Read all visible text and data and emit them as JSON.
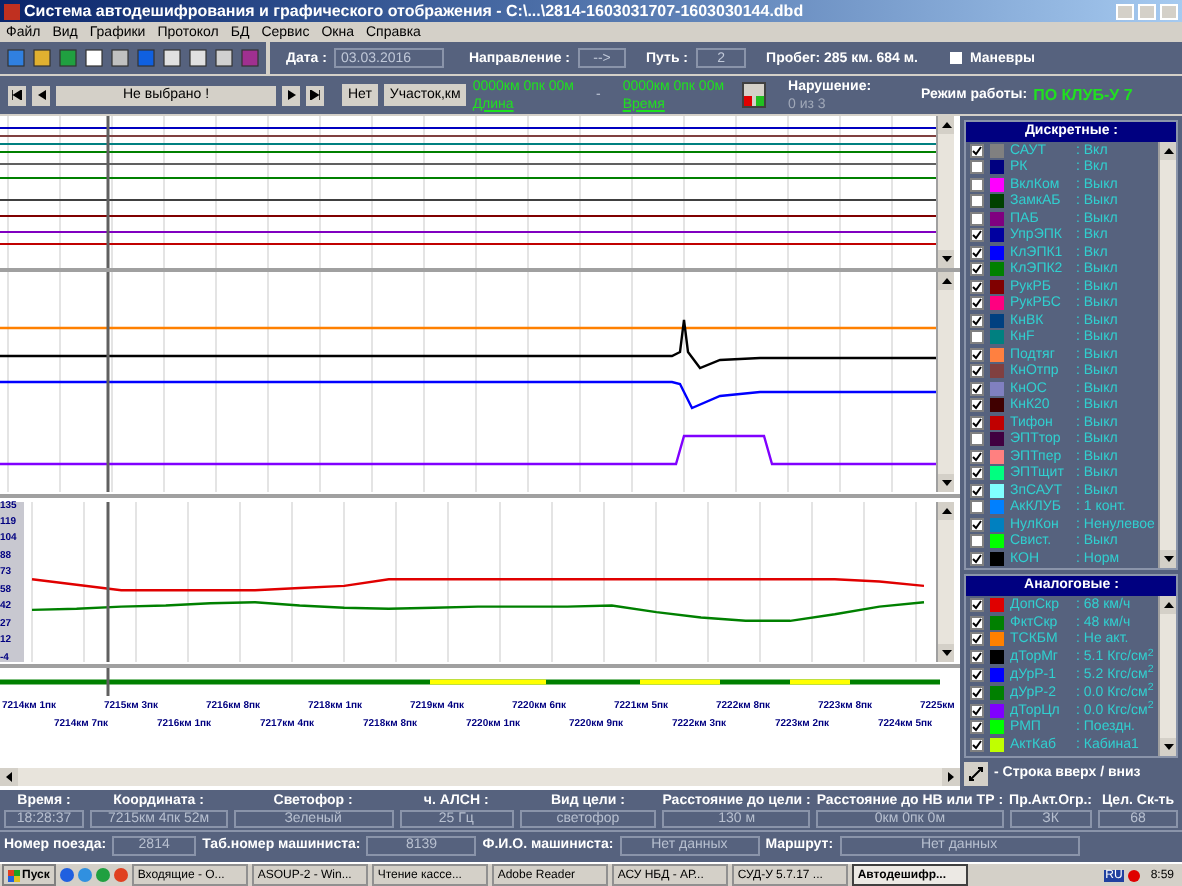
{
  "window": {
    "title": "Система автодешифрования и графического отображения - C:\\...\\2814-1603031707-1603030144.dbd"
  },
  "menu": [
    "Файл",
    "Вид",
    "Графики",
    "Протокол",
    "БД",
    "Сервис",
    "Окна",
    "Справка"
  ],
  "toolbar": {
    "date_label": "Дата :",
    "date": "03.03.2016",
    "direction_label": "Направление :",
    "direction": "-->",
    "track_label": "Путь :",
    "track": "2",
    "mileage": "Пробег: 285 км. 684 м.",
    "maneuvers": {
      "label": "Маневры",
      "checked": false
    }
  },
  "navigation": {
    "selection": "Не выбрано !",
    "no_button": "Нет",
    "section_button": "Участок,км",
    "from": "0000км 0пк 00м",
    "length_link": "Длина",
    "dash": "-",
    "to": "0000км 0пк 00м",
    "time_link": "Время",
    "violation_label": "Нарушение:",
    "violation_count": "0 из 3",
    "mode_label": "Режим работы:",
    "mode": "ПО КЛУБ-У 7"
  },
  "analog_chart": {
    "chart_data": {
      "type": "line",
      "grid": true,
      "ylim": [
        -4,
        135
      ],
      "yticks": [
        -4,
        12,
        27,
        42,
        58,
        73,
        88,
        104,
        119,
        135
      ],
      "series": [
        {
          "color": "#e00000",
          "values": [
            68,
            63,
            58,
            58,
            58,
            58,
            60,
            62,
            68,
            68,
            68,
            68,
            68,
            68,
            68,
            68,
            68,
            68,
            68,
            66,
            62
          ]
        },
        {
          "color": "#008000",
          "values": [
            40,
            41,
            43,
            44,
            46,
            47,
            44,
            42,
            41,
            42,
            43,
            43,
            43,
            44,
            38,
            33,
            30,
            30,
            36,
            43,
            47
          ]
        }
      ]
    }
  },
  "position_scale": {
    "row_1": [
      "7214км 1пк",
      "7215км 3пк",
      "7216км 8пк",
      "7218км 1пк",
      "7219км 4пк",
      "7220км 6пк",
      "7221км 5пк",
      "7222км 8пк",
      "7223км 8пк",
      "7225км"
    ],
    "row_2": [
      "7214км 7пк",
      "7216км 1пк",
      "7217км 4пк",
      "7218км 8пк",
      "7220км 1пк",
      "7220км 9пк",
      "7222км 3пк",
      "7223км 2пк",
      "7224км 5пк"
    ]
  },
  "discrete": {
    "title": "Дискретные :",
    "items": [
      {
        "name": "САУТ",
        "value": ": Вкл",
        "color": "#808080",
        "checked": true
      },
      {
        "name": "РК",
        "value": ": Вкл",
        "color": "#000080",
        "checked": false
      },
      {
        "name": "ВклКом",
        "value": ": Выкл",
        "color": "#ff00ff",
        "checked": false
      },
      {
        "name": "ЗамкАБ",
        "value": ": Выкл",
        "color": "#004000",
        "checked": false
      },
      {
        "name": "ПАБ",
        "value": ": Выкл",
        "color": "#800080",
        "checked": false
      },
      {
        "name": "УпрЭПК",
        "value": ": Вкл",
        "color": "#0000a0",
        "checked": true
      },
      {
        "name": "КлЭПК1",
        "value": ": Вкл",
        "color": "#0000ff",
        "checked": true
      },
      {
        "name": "КлЭПК2",
        "value": ": Выкл",
        "color": "#008000",
        "checked": true
      },
      {
        "name": "РукРБ",
        "value": ": Выкл",
        "color": "#800000",
        "checked": true
      },
      {
        "name": "РукРБС",
        "value": ": Выкл",
        "color": "#ff0080",
        "checked": true
      },
      {
        "name": "КнВК",
        "value": ": Выкл",
        "color": "#004080",
        "checked": true
      },
      {
        "name": "КнF",
        "value": ": Выкл",
        "color": "#008080",
        "checked": false
      },
      {
        "name": "Подтяг",
        "value": ": Выкл",
        "color": "#ff8040",
        "checked": true
      },
      {
        "name": "КнОтпр",
        "value": ": Выкл",
        "color": "#804040",
        "checked": true
      },
      {
        "name": "КнОС",
        "value": ": Выкл",
        "color": "#8080c0",
        "checked": true
      },
      {
        "name": "КнК20",
        "value": ": Выкл",
        "color": "#400000",
        "checked": true
      },
      {
        "name": "Тифон",
        "value": ": Выкл",
        "color": "#c00000",
        "checked": true
      },
      {
        "name": "ЭПТтор",
        "value": ": Выкл",
        "color": "#400040",
        "checked": false
      },
      {
        "name": "ЭПТпер",
        "value": ": Выкл",
        "color": "#ff8080",
        "checked": true
      },
      {
        "name": "ЭПТщит",
        "value": ": Выкл",
        "color": "#00ff80",
        "checked": true
      },
      {
        "name": "ЗпСАУТ",
        "value": ": Выкл",
        "color": "#80ffff",
        "checked": true
      },
      {
        "name": "АкКЛУБ",
        "value": ": 1 конт.",
        "color": "#0080ff",
        "checked": false
      },
      {
        "name": "НулКон",
        "value": ": Ненулевое",
        "color": "#0080c0",
        "checked": true
      },
      {
        "name": "Свист.",
        "value": ": Выкл",
        "color": "#00ff00",
        "checked": false
      },
      {
        "name": "КОН",
        "value": ": Норм",
        "color": "#000000",
        "checked": true
      }
    ]
  },
  "analog": {
    "title": "Аналоговые :",
    "items": [
      {
        "name": "ДопСкр",
        "value": ": 68 км/ч",
        "color": "#e00000",
        "checked": true
      },
      {
        "name": "ФктСкр",
        "value": ": 48 км/ч",
        "color": "#008000",
        "checked": true
      },
      {
        "name": "ТСКБМ",
        "value": ": Не акт.",
        "color": "#ff8000",
        "checked": true
      },
      {
        "name": "дТорМг",
        "value": ": 5.1 Кгс/см$^{2}$",
        "color": "#000000",
        "checked": true
      },
      {
        "name": "дУрР-1",
        "value": ": 5.2 Кгс/см$^{2}$",
        "color": "#0000ff",
        "checked": true
      },
      {
        "name": "дУрР-2",
        "value": ": 0.0 Кгс/см$^{2}$",
        "color": "#008000",
        "checked": true
      },
      {
        "name": "дТорЦл",
        "value": ": 0.0 Кгс/см$^{2}$",
        "color": "#8000ff",
        "checked": true
      },
      {
        "name": "РМП",
        "value": ": Поездн.",
        "color": "#00ff00",
        "checked": true
      },
      {
        "name": "АктКаб",
        "value": ": Кабина1",
        "color": "#c0ff00",
        "checked": true
      }
    ]
  },
  "row_scroll_hint": "- Строка вверх / вниз",
  "info_row_1": [
    {
      "label": "Время :",
      "value": "18:28:37"
    },
    {
      "label": "Координата :",
      "value": "7215км 4пк 52м"
    },
    {
      "label": "Светофор :",
      "value": "Зеленый"
    },
    {
      "label": "ч. АЛСН :",
      "value": "25 Гц"
    },
    {
      "label": "Вид цели :",
      "value": "светофор"
    },
    {
      "label": "Расстояние до цели :",
      "value": "130 м"
    },
    {
      "label": "Расстояние до НВ или ТР :",
      "value": "0км 0пк 0м"
    },
    {
      "label": "Пр.Акт.Огр.:",
      "value": "ЗК"
    },
    {
      "label": "Цел. Ск-ть",
      "value": "68"
    }
  ],
  "info_row_2": [
    {
      "label": "Номер поезда:",
      "value": "2814"
    },
    {
      "label": "Таб.номер машиниста:",
      "value": "8139"
    },
    {
      "label": "Ф.И.О. машиниста:",
      "value": "Нет данных"
    },
    {
      "label": "Маршрут:",
      "value": "Нет данных"
    }
  ],
  "taskbar": {
    "start": "Пуск",
    "tasks": [
      {
        "label": "Входящие - О...",
        "selected": false
      },
      {
        "label": "ASOUP-2 - Win...",
        "selected": false
      },
      {
        "label": "Чтение кассе...",
        "selected": false
      },
      {
        "label": "Adobe Reader",
        "selected": false
      },
      {
        "label": "АСУ НБД - АР...",
        "selected": false
      },
      {
        "label": "СУД-У 5.7.17 ...",
        "selected": false
      },
      {
        "label": "Автодешифр...",
        "selected": true
      }
    ],
    "language": "RU",
    "clock": "8:59"
  }
}
